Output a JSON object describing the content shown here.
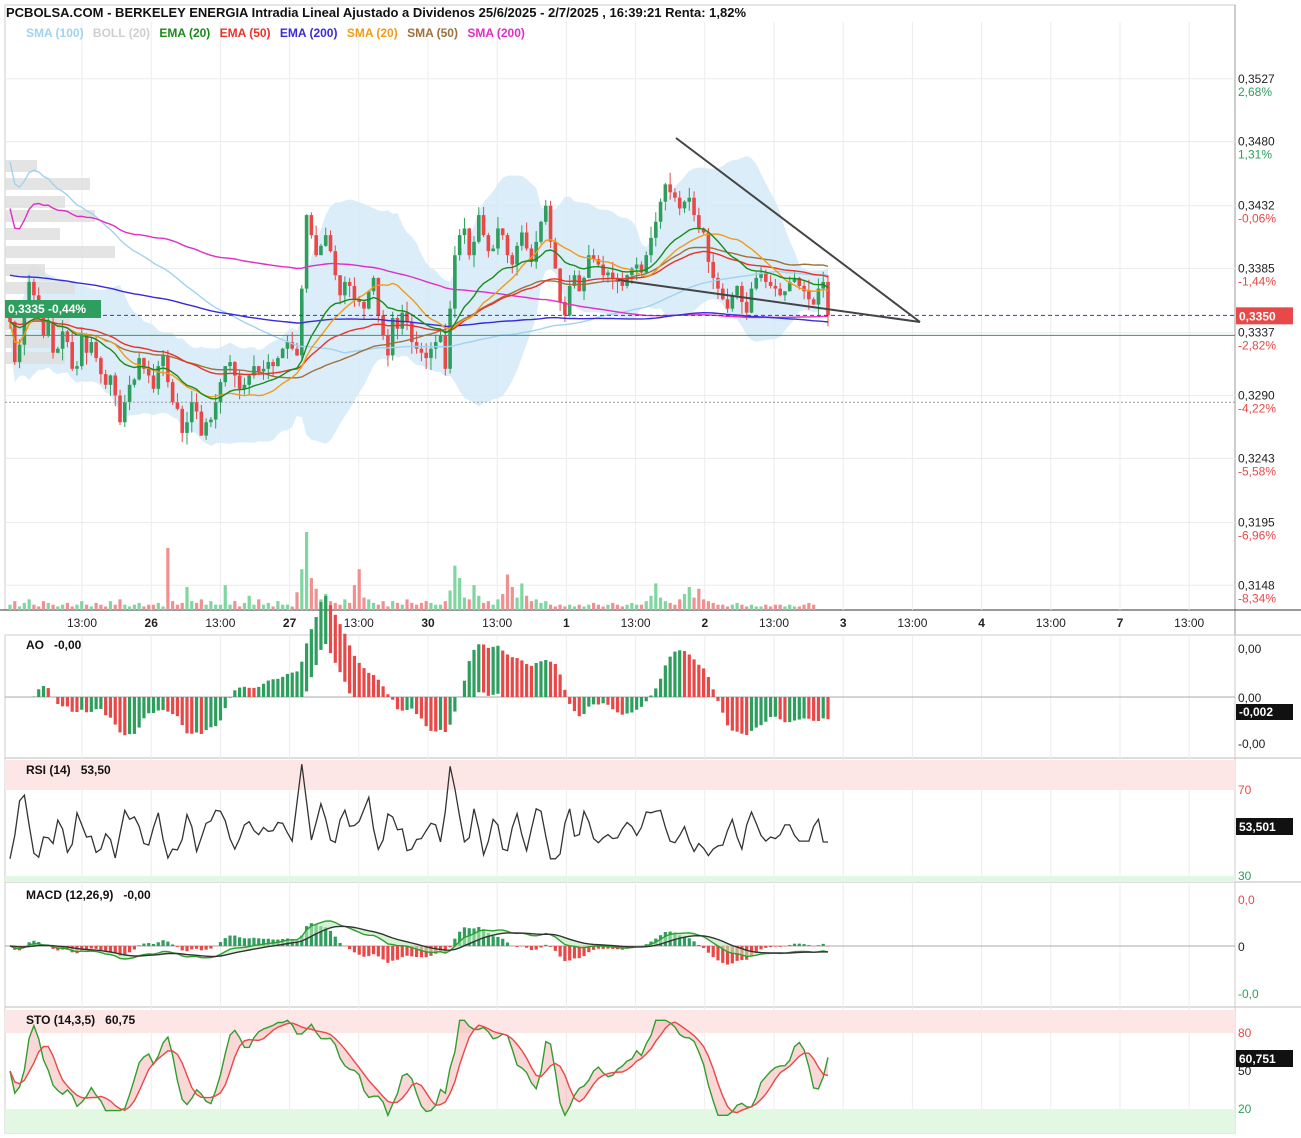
{
  "header": {
    "title": "PCBOLSA.COM - BERKELEY ENERGIA Intradia Lineal Ajustado a Dividenos 25/6/2025 - 2/7/2025 , 16:39:21 Renta: 1,82%"
  },
  "legend": [
    {
      "label": "SMA (100)",
      "color": "#9fd3f0"
    },
    {
      "label": "BOLL (20)",
      "color": "#cfcfcf"
    },
    {
      "label": "EMA (20)",
      "color": "#1a8a1a"
    },
    {
      "label": "EMA (50)",
      "color": "#e8332a"
    },
    {
      "label": "EMA (200)",
      "color": "#3a2ad8"
    },
    {
      "label": "SMA (20)",
      "color": "#f29b16"
    },
    {
      "label": "SMA (50)",
      "color": "#a0703c"
    },
    {
      "label": "SMA (200)",
      "color": "#e12ec4"
    }
  ],
  "colors": {
    "up": "#2e9e5e",
    "down": "#e84848",
    "up_volume": "#7fd6a0",
    "down_volume": "#f09090",
    "boll_fill": "#d3eaf8"
  },
  "chart_data": [
    {
      "type": "candlestick",
      "name": "price",
      "y_ticks": [
        {
          "value": "0,3527",
          "pct": "2,68%"
        },
        {
          "value": "0,3480",
          "pct": "1,31%"
        },
        {
          "value": "0,3432",
          "pct": "-0,06%"
        },
        {
          "value": "0,3385",
          "pct": "-1,44%"
        },
        {
          "value": "0,3337",
          "pct": "-2,82%"
        },
        {
          "value": "0,3290",
          "pct": "-4,22%"
        },
        {
          "value": "0,3243",
          "pct": "-5,58%"
        },
        {
          "value": "0,3195",
          "pct": "-6,96%"
        },
        {
          "value": "0,3148",
          "pct": "-8,34%"
        }
      ],
      "ylim": [
        0.3128,
        0.3568
      ],
      "last_price_label": "0,3350",
      "last_price": 0.335,
      "left_price_label": "0,3335 -0,44%",
      "support_level": 0.3335,
      "gray_level": 0.3285,
      "x_ticks": [
        "13:00",
        "26",
        "13:00",
        "27",
        "13:00",
        "30",
        "13:00",
        "1",
        "13:00",
        "2",
        "13:00",
        "3",
        "13:00",
        "4",
        "13:00",
        "7",
        "13:00"
      ],
      "closes": [
        0.3345,
        0.3315,
        0.3328,
        0.3355,
        0.3375,
        0.3365,
        0.335,
        0.3335,
        0.3345,
        0.3322,
        0.3325,
        0.3338,
        0.333,
        0.331,
        0.3312,
        0.3335,
        0.3322,
        0.333,
        0.3318,
        0.3306,
        0.3298,
        0.3305,
        0.329,
        0.327,
        0.3285,
        0.3298,
        0.3302,
        0.3318,
        0.331,
        0.3305,
        0.3295,
        0.3312,
        0.332,
        0.33,
        0.3285,
        0.328,
        0.3262,
        0.327,
        0.3285,
        0.3278,
        0.326,
        0.327,
        0.3272,
        0.3285,
        0.33,
        0.3312,
        0.3315,
        0.3305,
        0.3295,
        0.3298,
        0.3305,
        0.3312,
        0.3308,
        0.331,
        0.3315,
        0.3312,
        0.3318,
        0.3325,
        0.333,
        0.3325,
        0.332,
        0.337,
        0.3425,
        0.341,
        0.3395,
        0.3402,
        0.341,
        0.3398,
        0.338,
        0.3365,
        0.3375,
        0.3372,
        0.3362,
        0.336,
        0.3355,
        0.3368,
        0.3378,
        0.335,
        0.3335,
        0.332,
        0.3348,
        0.334,
        0.3352,
        0.3345,
        0.333,
        0.3325,
        0.3322,
        0.3318,
        0.3325,
        0.333,
        0.3335,
        0.331,
        0.3355,
        0.3395,
        0.341,
        0.3415,
        0.3395,
        0.3405,
        0.3425,
        0.341,
        0.3398,
        0.34,
        0.3415,
        0.341,
        0.3395,
        0.3388,
        0.3402,
        0.3412,
        0.34,
        0.339,
        0.3405,
        0.342,
        0.3432,
        0.3405,
        0.3385,
        0.336,
        0.335,
        0.3372,
        0.338,
        0.3368,
        0.3378,
        0.3395,
        0.3392,
        0.3388,
        0.338,
        0.3382,
        0.3378,
        0.3375,
        0.3372,
        0.338,
        0.3385,
        0.3388,
        0.3382,
        0.3395,
        0.3408,
        0.342,
        0.3435,
        0.3448,
        0.3442,
        0.3438,
        0.343,
        0.3435,
        0.3438,
        0.3425,
        0.3415,
        0.3412,
        0.339,
        0.3378,
        0.337,
        0.3362,
        0.3355,
        0.3365,
        0.3372,
        0.336,
        0.3352,
        0.337,
        0.3378,
        0.3382,
        0.3375,
        0.3372,
        0.337,
        0.3365,
        0.3368,
        0.3375,
        0.3378,
        0.3372,
        0.3368,
        0.3362,
        0.3358,
        0.337,
        0.3375,
        0.335
      ]
    },
    {
      "type": "bar",
      "name": "volume",
      "values": [
        0.3,
        0.5,
        0.2,
        0.4,
        0.6,
        0.3,
        0.2,
        0.5,
        0.4,
        0.3,
        0.2,
        0.3,
        0.4,
        0.2,
        0.3,
        0.5,
        0.3,
        0.2,
        0.4,
        0.3,
        0.2,
        0.5,
        0.3,
        0.6,
        0.3,
        0.2,
        0.3,
        0.4,
        0.2,
        0.3,
        0.3,
        0.4,
        0.2,
        3.5,
        0.5,
        0.3,
        0.4,
        1.3,
        0.5,
        0.4,
        0.6,
        0.3,
        0.5,
        0.3,
        0.3,
        1.4,
        0.3,
        0.5,
        0.2,
        0.4,
        0.8,
        0.3,
        0.6,
        0.3,
        0.4,
        0.2,
        0.5,
        0.3,
        0.3,
        0.2,
        1.0,
        2.3,
        4.4,
        1.8,
        1.2,
        0.6,
        0.9,
        0.5,
        0.4,
        0.3,
        0.6,
        0.4,
        1.4,
        2.3,
        0.7,
        0.6,
        0.4,
        0.3,
        0.5,
        0.2,
        0.5,
        0.4,
        0.3,
        0.6,
        0.4,
        0.3,
        0.4,
        0.5,
        0.4,
        0.3,
        0.3,
        0.5,
        1.1,
        2.5,
        1.8,
        0.7,
        0.6,
        1.4,
        0.8,
        0.4,
        0.5,
        0.3,
        0.6,
        0.9,
        2.0,
        1.3,
        0.7,
        1.5,
        0.8,
        0.5,
        0.6,
        0.4,
        0.5,
        0.3,
        0.2,
        0.3,
        0.2,
        0.3,
        0.2,
        0.3,
        0.2,
        0.3,
        0.4,
        0.3,
        0.2,
        0.3,
        0.4,
        0.3,
        0.2,
        0.3,
        0.4,
        0.3,
        0.3,
        0.5,
        0.8,
        1.5,
        0.7,
        0.5,
        0.4,
        0.3,
        0.6,
        0.9,
        1.3,
        0.7,
        1.2,
        0.6,
        0.5,
        0.4,
        0.3,
        0.3,
        0.2,
        0.3,
        0.4,
        0.3,
        0.2,
        0.3,
        0.2,
        0.2,
        0.3,
        0.2,
        0.3,
        0.3,
        0.2,
        0.3,
        0.2,
        0.2,
        0.3,
        0.4,
        0.3
      ]
    },
    {
      "type": "bar",
      "name": "AO",
      "label": "AO",
      "value_label": "-0,00",
      "last_label": "-0,002",
      "y_ticks": [
        "0,00",
        "0,00",
        "-0,00"
      ]
    },
    {
      "type": "line",
      "name": "RSI",
      "label": "RSI (14)",
      "value_label": "53,50",
      "last_label": "53,501",
      "y_ticks": [
        "70",
        "30"
      ],
      "ylim": [
        15,
        85
      ]
    },
    {
      "type": "line",
      "name": "MACD",
      "label": "MACD (12,26,9)",
      "value_label": "-0,00",
      "y_ticks": [
        "0,0",
        "0",
        "-0,0"
      ]
    },
    {
      "type": "line",
      "name": "STO",
      "label": "STO (14,3,5)",
      "value_label": "60,75",
      "last_label": "60,751",
      "y_ticks": [
        "80",
        "50",
        "20"
      ],
      "ylim": [
        10,
        95
      ]
    }
  ]
}
